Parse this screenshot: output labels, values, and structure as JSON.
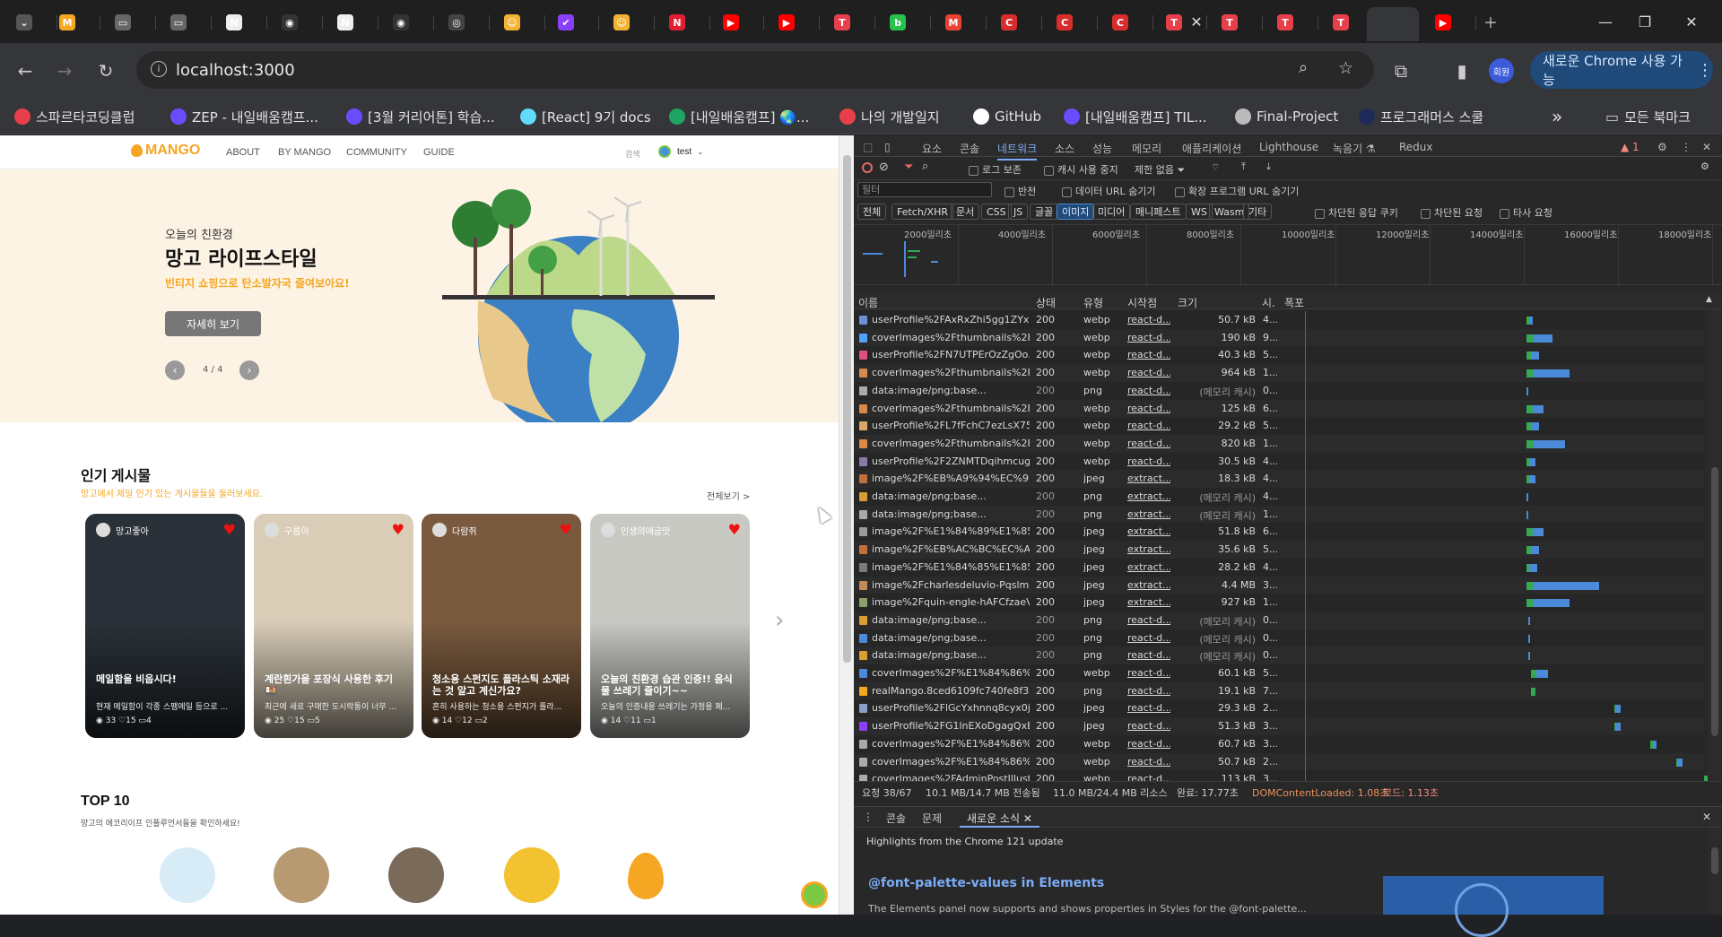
{
  "browser": {
    "tabs": [
      {
        "label": "",
        "color": "#555555",
        "glyph": "⌄"
      },
      {
        "label": "",
        "color": "#f5a623",
        "glyph": "M"
      },
      {
        "label": "",
        "color": "#666666",
        "glyph": "▭"
      },
      {
        "label": "",
        "color": "#666666",
        "glyph": "▭"
      },
      {
        "label": "",
        "color": "#eeeeee",
        "glyph": "N"
      },
      {
        "label": "",
        "color": "#333333",
        "glyph": "◉"
      },
      {
        "label": "",
        "color": "#eeeeee",
        "glyph": "N"
      },
      {
        "label": "",
        "color": "#333333",
        "glyph": "◉"
      },
      {
        "label": "",
        "color": "#444444",
        "glyph": "◎"
      },
      {
        "label": "",
        "color": "#f2b233",
        "glyph": "☺"
      },
      {
        "label": "",
        "color": "#8a3ffc",
        "glyph": "✔"
      },
      {
        "label": "",
        "color": "#f2b233",
        "glyph": "☺"
      },
      {
        "label": "",
        "color": "#e11d2f",
        "glyph": "N"
      },
      {
        "label": "",
        "color": "#ff0000",
        "glyph": "▶"
      },
      {
        "label": "",
        "color": "#ff0000",
        "glyph": "▶"
      },
      {
        "label": "",
        "color": "#e8404a",
        "glyph": "T"
      },
      {
        "label": "",
        "color": "#27c24c",
        "glyph": "b"
      },
      {
        "label": "",
        "color": "#ea4335",
        "glyph": "M"
      },
      {
        "label": "",
        "color": "#d92d2d",
        "glyph": "C"
      },
      {
        "label": "",
        "color": "#d92d2d",
        "glyph": "C"
      },
      {
        "label": "",
        "color": "#d92d2d",
        "glyph": "C"
      },
      {
        "label": "",
        "color": "#e8404a",
        "glyph": "T"
      },
      {
        "label": "",
        "color": "#e8404a",
        "glyph": "T"
      },
      {
        "label": "",
        "color": "#e8404a",
        "glyph": "T"
      },
      {
        "label": "",
        "color": "#e8404a",
        "glyph": "T"
      },
      {
        "label": "",
        "color": "#35363a",
        "glyph": ""
      },
      {
        "label": "",
        "color": "#ff0000",
        "glyph": "▶"
      }
    ],
    "url": "localhost:3000",
    "profile_label": "회원",
    "update_button": "새로운 Chrome 사용 가능",
    "bookmarks": [
      {
        "label": "스파르타코딩클럽",
        "color": "#e8404a"
      },
      {
        "label": "ZEP - 내일배움캠프...",
        "color": "#6a4cff"
      },
      {
        "label": "[3월 커리어톤] 학습...",
        "color": "#6a4cff"
      },
      {
        "label": "[React] 9기 docs",
        "color": "#61dafb"
      },
      {
        "label": "[내일배움캠프] 🌏...",
        "color": "#1fa463"
      },
      {
        "label": "나의 개발일지",
        "color": "#e8404a"
      },
      {
        "label": "GitHub",
        "color": "#ffffff"
      },
      {
        "label": "[내일배움캠프] TIL...",
        "color": "#6a4cff"
      },
      {
        "label": "Final-Project",
        "color": "#bbbbbb"
      },
      {
        "label": "프로그래머스 스쿨",
        "color": "#1e2a5a"
      }
    ],
    "more_bookmarks": "»",
    "all_bookmarks": "모든 북마크"
  },
  "site": {
    "logo": "MANGO",
    "nav": [
      "ABOUT",
      "BY MANGO",
      "COMMUNITY",
      "GUIDE"
    ],
    "search_label": "검색",
    "user": "test",
    "hero": {
      "eyebrow": "오늘의 친환경",
      "title": "망고 라이프스타일",
      "subtitle": "빈티지 쇼핑으로 탄소발자국 줄여보아요!",
      "button": "자세히 보기",
      "pager": "4 / 4"
    },
    "popular": {
      "title": "인기 게시물",
      "subtitle": "망고에서 제일 인기 있는 게시물들을 둘러보세요.",
      "view_all": "전체보기 >",
      "cards": [
        {
          "user": "망고좋아",
          "title": "메일함을 비웁시다!",
          "desc": "현재 메일함이 각종 스팸메일 등으로 ...",
          "likes": "33",
          "hearts": "15",
          "comments": "4",
          "bg": "#2a3138"
        },
        {
          "user": "구름이",
          "title": "계란흰가을 포장식 사용한 후기 🍱",
          "desc": "최근에 새로 구매한 도시락통이 너무 ...",
          "likes": "25",
          "hearts": "15",
          "comments": "5",
          "bg": "#d9cdb8"
        },
        {
          "user": "다람쥐",
          "title": "청소용 스펀지도 플라스틱 소재라는 것 알고 계신가요?",
          "desc": "흔히 사용하는 청소용 스펀지가 플라...",
          "likes": "14",
          "hearts": "12",
          "comments": "2",
          "bg": "#7a5a3e"
        },
        {
          "user": "인생의애굽맛",
          "title": "오늘의 친환경 습관 인증!! 음식물 쓰레기 줄이기~~",
          "desc": "오늘의 인증내용 쓰레기는 가정용 폐...",
          "likes": "14",
          "hearts": "11",
          "comments": "1",
          "bg": "#c9c9c4"
        }
      ]
    },
    "top10": {
      "title": "TOP 10",
      "subtitle": "망고의 에코리이프 인플루언서들을 확인하세요!"
    }
  },
  "devtools": {
    "tabs": [
      "요소",
      "콘솔",
      "네트워크",
      "소스",
      "성능",
      "메모리",
      "애플리케이션",
      "Lighthouse",
      "녹음기 ⚗",
      "Redux"
    ],
    "active_tab": "네트워크",
    "issues_count": "1",
    "toolbar": {
      "preserve_log": "로그 보존",
      "disable_cache": "캐시 사용 중지",
      "throttle": "제한 없음"
    },
    "filter_placeholder": "필터",
    "invert": "반전",
    "hide_data_urls": "데이터 URL 숨기기",
    "hide_ext_urls": "확장 프로그램 URL 숨기기",
    "type_filters": [
      "전체",
      "Fetch/XHR",
      "문서",
      "CSS",
      "JS",
      "글꼴",
      "이미지",
      "미디어",
      "매니페스트",
      "WS",
      "Wasm",
      "기타"
    ],
    "active_filter": "이미지",
    "blocked_cookies": "차단된 응답 쿠키",
    "blocked_requests": "차단된 요청",
    "third_party": "타사 요청",
    "timeline_ticks": [
      "2000밀리초",
      "4000밀리초",
      "6000밀리초",
      "8000밀리초",
      "10000밀리초",
      "12000밀리초",
      "14000밀리초",
      "16000밀리초",
      "18000밀리초"
    ],
    "columns": [
      "이름",
      "상태",
      "유형",
      "시작점",
      "크기",
      "시.",
      "폭포"
    ],
    "rows": [
      {
        "name": "userProfile%2FAxRxZhi5gg1ZYxG...",
        "status": "200",
        "type": "webp",
        "initiator": "react-d...",
        "size": "50.7 kB",
        "time": "4...",
        "wf_start": 0.58,
        "wf_len": 0.015,
        "icon": "#6a8fd8"
      },
      {
        "name": "coverImages%2Fthumbnails%2F...",
        "status": "200",
        "type": "webp",
        "initiator": "react-d...",
        "size": "190 kB",
        "time": "9...",
        "wf_start": 0.58,
        "wf_len": 0.06,
        "icon": "#4aa3ff"
      },
      {
        "name": "userProfile%2FN7UTPErOzZgOo...",
        "status": "200",
        "type": "webp",
        "initiator": "react-d...",
        "size": "40.3 kB",
        "time": "5...",
        "wf_start": 0.58,
        "wf_len": 0.03,
        "icon": "#e0507a"
      },
      {
        "name": "coverImages%2Fthumbnails%2F...",
        "status": "200",
        "type": "webp",
        "initiator": "react-d...",
        "size": "964 kB",
        "time": "1...",
        "wf_start": 0.58,
        "wf_len": 0.1,
        "icon": "#d98a4a"
      },
      {
        "name": "data:image/png;base...",
        "status": "200",
        "type": "png",
        "initiator": "react-d...",
        "size": "(메모리 캐시)",
        "time": "0...",
        "wf_start": 0.58,
        "wf_len": 0.003,
        "icon": "#aaaaaa"
      },
      {
        "name": "coverImages%2Fthumbnails%2F...",
        "status": "200",
        "type": "webp",
        "initiator": "react-d...",
        "size": "125 kB",
        "time": "6...",
        "wf_start": 0.58,
        "wf_len": 0.04,
        "icon": "#d98a4a"
      },
      {
        "name": "userProfile%2FL7fFchC7ezLsX75s...",
        "status": "200",
        "type": "webp",
        "initiator": "react-d...",
        "size": "29.2 kB",
        "time": "5...",
        "wf_start": 0.58,
        "wf_len": 0.03,
        "icon": "#d9a86a"
      },
      {
        "name": "coverImages%2Fthumbnails%2F...",
        "status": "200",
        "type": "webp",
        "initiator": "react-d...",
        "size": "820 kB",
        "time": "1...",
        "wf_start": 0.58,
        "wf_len": 0.09,
        "icon": "#d98a4a"
      },
      {
        "name": "userProfile%2F2ZNMTDqihmcug...",
        "status": "200",
        "type": "webp",
        "initiator": "react-d...",
        "size": "30.5 kB",
        "time": "4...",
        "wf_start": 0.58,
        "wf_len": 0.02,
        "icon": "#8a7aa8"
      },
      {
        "name": "image%2F%EB%A9%94%EC%9D...",
        "status": "200",
        "type": "jpeg",
        "initiator": "extract...",
        "size": "18.3 kB",
        "time": "4...",
        "wf_start": 0.58,
        "wf_len": 0.02,
        "icon": "#c0703a"
      },
      {
        "name": "data:image/png;base...",
        "status": "200",
        "type": "png",
        "initiator": "extract...",
        "size": "(메모리 캐시)",
        "time": "4...",
        "wf_start": 0.58,
        "wf_len": 0.003,
        "icon": "#d9a030"
      },
      {
        "name": "data:image/png;base...",
        "status": "200",
        "type": "png",
        "initiator": "extract...",
        "size": "(메모리 캐시)",
        "time": "1...",
        "wf_start": 0.58,
        "wf_len": 0.003,
        "icon": "#aaaaaa"
      },
      {
        "name": "image%2F%E1%84%89%E1%85...",
        "status": "200",
        "type": "jpeg",
        "initiator": "extract...",
        "size": "51.8 kB",
        "time": "6...",
        "wf_start": 0.58,
        "wf_len": 0.04,
        "icon": "#9a9a9a"
      },
      {
        "name": "image%2F%EB%AC%BC%EC%A0...",
        "status": "200",
        "type": "jpeg",
        "initiator": "extract...",
        "size": "35.6 kB",
        "time": "5...",
        "wf_start": 0.58,
        "wf_len": 0.03,
        "icon": "#c0703a"
      },
      {
        "name": "image%2F%E1%84%85%E1%85...",
        "status": "200",
        "type": "jpeg",
        "initiator": "extract...",
        "size": "28.2 kB",
        "time": "4...",
        "wf_start": 0.58,
        "wf_len": 0.025,
        "icon": "#7a7a7a"
      },
      {
        "name": "image%2Fcharlesdeluvio-Pqslmn...",
        "status": "200",
        "type": "jpeg",
        "initiator": "extract...",
        "size": "4.4 MB",
        "time": "3...",
        "wf_start": 0.58,
        "wf_len": 0.17,
        "icon": "#c08a5a"
      },
      {
        "name": "image%2Fquin-engle-hAFCfzaeV...",
        "status": "200",
        "type": "jpeg",
        "initiator": "extract...",
        "size": "927 kB",
        "time": "1...",
        "wf_start": 0.58,
        "wf_len": 0.1,
        "icon": "#8aa06a"
      },
      {
        "name": "data:image/png;base...",
        "status": "200",
        "type": "png",
        "initiator": "react-d...",
        "size": "(메모리 캐시)",
        "time": "0...",
        "wf_start": 0.585,
        "wf_len": 0.003,
        "icon": "#d9a030"
      },
      {
        "name": "data:image/png;base...",
        "status": "200",
        "type": "png",
        "initiator": "react-d...",
        "size": "(메모리 캐시)",
        "time": "0...",
        "wf_start": 0.585,
        "wf_len": 0.003,
        "icon": "#4a8ad8"
      },
      {
        "name": "data:image/png;base...",
        "status": "200",
        "type": "png",
        "initiator": "react-d...",
        "size": "(메모리 캐시)",
        "time": "0...",
        "wf_start": 0.585,
        "wf_len": 0.003,
        "icon": "#d9a030"
      },
      {
        "name": "coverImages%2F%E1%84%86%E...",
        "status": "200",
        "type": "webp",
        "initiator": "react-d...",
        "size": "60.1 kB",
        "time": "5...",
        "wf_start": 0.59,
        "wf_len": 0.04,
        "icon": "#4a8ad8"
      },
      {
        "name": "realMango.8ced6109fc740fe8f32...",
        "status": "200",
        "type": "png",
        "initiator": "react-d...",
        "size": "19.1 kB",
        "time": "7...",
        "wf_start": 0.59,
        "wf_len": 0.01,
        "icon": "#f5a623"
      },
      {
        "name": "userProfile%2FlGcYxhnnq8cyx0j9...",
        "status": "200",
        "type": "jpeg",
        "initiator": "react-d...",
        "size": "29.3 kB",
        "time": "2...",
        "wf_start": 0.785,
        "wf_len": 0.015,
        "icon": "#8aa0c8"
      },
      {
        "name": "userProfile%2FG1lnEXoDgagQxE...",
        "status": "200",
        "type": "jpeg",
        "initiator": "react-d...",
        "size": "51.3 kB",
        "time": "3...",
        "wf_start": 0.785,
        "wf_len": 0.015,
        "icon": "#8a3ffc"
      },
      {
        "name": "coverImages%2F%E1%84%86%E...",
        "status": "200",
        "type": "webp",
        "initiator": "react-d...",
        "size": "60.7 kB",
        "time": "3...",
        "wf_start": 0.87,
        "wf_len": 0.015,
        "icon": "#aaaaaa"
      },
      {
        "name": "coverImages%2F%E1%84%86%E...",
        "status": "200",
        "type": "webp",
        "initiator": "react-d...",
        "size": "50.7 kB",
        "time": "2...",
        "wf_start": 0.93,
        "wf_len": 0.015,
        "icon": "#aaaaaa"
      },
      {
        "name": "coverImages%2FAdminPostIllustr...",
        "status": "200",
        "type": "webp",
        "initiator": "react-d...",
        "size": "113 kB",
        "time": "3...",
        "wf_start": 0.995,
        "wf_len": 0.01,
        "icon": "#aaaaaa"
      }
    ],
    "summary": {
      "requests": "요청 38/67",
      "transferred": "10.1 MB/14.7 MB 전송됨",
      "resources": "11.0 MB/24.4 MB 리소스",
      "finish": "완료: 17.77초",
      "dcl": "DOMContentLoaded: 1.08초",
      "load": "로드: 1.13초"
    },
    "drawer": {
      "tabs": [
        "콘솔",
        "문제",
        "새로운 소식"
      ],
      "active": "새로운 소식",
      "highlights": "Highlights from the Chrome 121 update",
      "heading": "@font-palette-values in Elements",
      "body": "The Elements panel now supports and shows properties in Styles for the @font-palette..."
    }
  }
}
